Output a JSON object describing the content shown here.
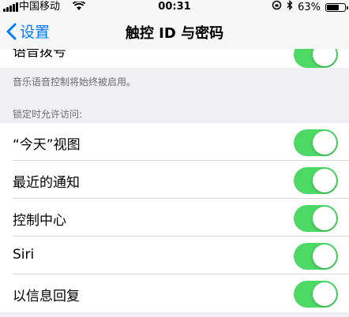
{
  "status_bar": {
    "carrier": "中国移动",
    "time": "00:31",
    "battery": "63%",
    "battery_level": 0.63
  },
  "nav": {
    "back_label": "设置",
    "title": "触控 ID 与密码"
  },
  "top_row": {
    "label": "语音拨号",
    "toggle_on": true
  },
  "voice_note": "音乐语音控制将始终被启用。",
  "section_header": "锁定时允许访问:",
  "items": [
    {
      "label": "“今天”视图",
      "toggle_on": true
    },
    {
      "label": "最近的通知",
      "toggle_on": true
    },
    {
      "label": "控制中心",
      "toggle_on": true
    },
    {
      "label": "Siri",
      "toggle_on": true
    },
    {
      "label": "以信息回复",
      "toggle_on": true
    }
  ],
  "colors": {
    "accent": "#007aff",
    "toggle_on": "#4cd964",
    "background": "#efeff4"
  }
}
